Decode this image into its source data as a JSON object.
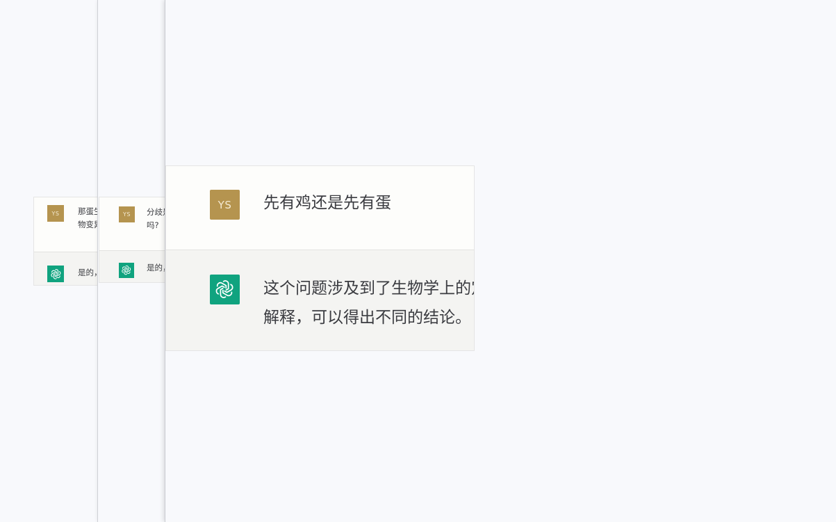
{
  "colors": {
    "background": "#f8f9fc",
    "user_avatar": "#b5944f",
    "assistant_avatar": "#10a37f",
    "user_row": "#fdfdfb",
    "assistant_row": "#f4f4f2"
  },
  "panels": [
    {
      "user": {
        "avatar": "YS",
        "text_lines": [
          "那蛋生",
          "物变异"
        ]
      },
      "assistant": {
        "avatar_icon": "openai-logo-icon",
        "text_lines": [
          "是的，"
        ]
      }
    },
    {
      "user": {
        "avatar": "YS",
        "text_lines": [
          "分歧是",
          "吗?"
        ]
      },
      "assistant": {
        "avatar_icon": "openai-logo-icon",
        "text_lines": [
          "是的，",
          "..."
        ]
      }
    },
    {
      "user": {
        "avatar": "YS",
        "text_lines": [
          "先有鸡还是先有蛋"
        ]
      },
      "assistant": {
        "avatar_icon": "openai-logo-icon",
        "text_lines": [
          "这个问题涉及到了生物学上的定",
          "解释，可以得出不同的结论。"
        ]
      }
    }
  ]
}
